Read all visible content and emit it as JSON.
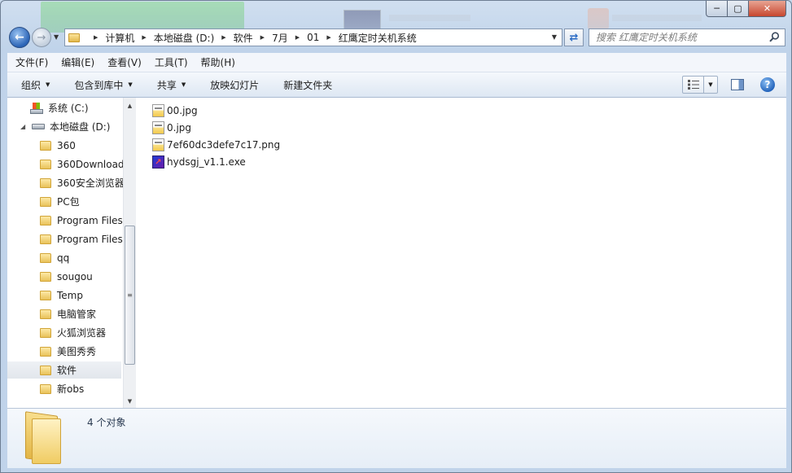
{
  "window": {
    "caption": {
      "minimize": "─",
      "maximize": "▢",
      "close": "✕"
    }
  },
  "nav": {
    "back_glyph": "←",
    "forward_glyph": "→",
    "breadcrumb": [
      "计算机",
      "本地磁盘 (D:)",
      "软件",
      "7月",
      "01",
      "红鹰定时关机系统"
    ],
    "search_placeholder": "搜索 红鹰定时关机系统"
  },
  "menubar": [
    "文件(F)",
    "编辑(E)",
    "查看(V)",
    "工具(T)",
    "帮助(H)"
  ],
  "toolbar": {
    "organize": "组织",
    "include_in_library": "包含到库中",
    "share": "共享",
    "slideshow": "放映幻灯片",
    "new_folder": "新建文件夹",
    "help_glyph": "?"
  },
  "tree": [
    {
      "label": "系统 (C:)",
      "icon": "system-drive-icon"
    },
    {
      "label": "本地磁盘 (D:)",
      "icon": "drive-icon",
      "expanded": true
    },
    {
      "label": "360",
      "icon": "folder-icon"
    },
    {
      "label": "360Download",
      "icon": "folder-icon"
    },
    {
      "label": "360安全浏览器",
      "icon": "folder-icon"
    },
    {
      "label": "PC包",
      "icon": "folder-icon"
    },
    {
      "label": "Program Files",
      "icon": "folder-icon"
    },
    {
      "label": "Program Files",
      "icon": "folder-icon"
    },
    {
      "label": "qq",
      "icon": "folder-icon"
    },
    {
      "label": "sougou",
      "icon": "folder-icon"
    },
    {
      "label": "Temp",
      "icon": "folder-icon"
    },
    {
      "label": "电脑管家",
      "icon": "folder-icon"
    },
    {
      "label": "火狐浏览器",
      "icon": "folder-icon"
    },
    {
      "label": "美图秀秀",
      "icon": "folder-icon"
    },
    {
      "label": "软件",
      "icon": "folder-icon",
      "selected": true
    },
    {
      "label": "新obs",
      "icon": "folder-icon"
    }
  ],
  "files": [
    {
      "name": "00.jpg",
      "icon": "image-file-icon"
    },
    {
      "name": "0.jpg",
      "icon": "image-file-icon"
    },
    {
      "name": "7ef60dc3defe7c17.png",
      "icon": "image-file-icon"
    },
    {
      "name": "hydsgj_v1.1.exe",
      "icon": "exe-file-icon"
    }
  ],
  "details": {
    "count_text": "4 个对象"
  },
  "colors": {
    "accent": "#2b64b6",
    "close_button": "#c7472f",
    "folder": "#e9c25a"
  }
}
